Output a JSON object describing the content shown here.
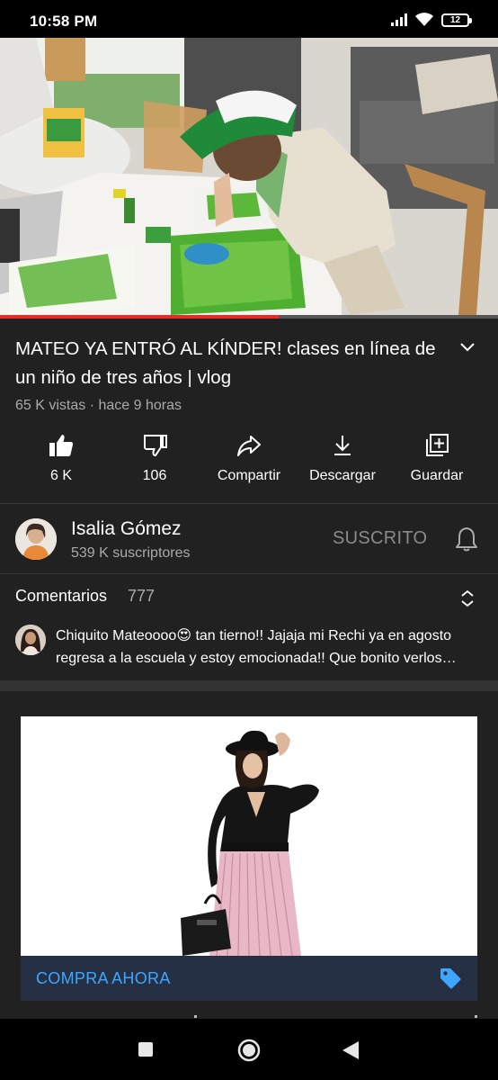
{
  "status_bar": {
    "time": "10:58 PM",
    "battery": "12"
  },
  "video": {
    "progress_percent": 56
  },
  "title": "MATEO YA ENTRÓ AL KÍNDER! clases en línea de un niño de tres años | vlog",
  "meta": "65 K vistas · hace 9 horas",
  "actions": {
    "like": "6 K",
    "dislike": "106",
    "share": "Compartir",
    "download": "Descargar",
    "save": "Guardar"
  },
  "channel": {
    "name": "Isalia Gómez",
    "subscribers": "539 K suscriptores",
    "subscribe_state": "SUSCRITO"
  },
  "comments": {
    "heading": "Comentarios",
    "count": "777",
    "top_comment": "Chiquito Mateoooo😍 tan tierno!! Jajaja mi Rechi ya en agosto regresa a la escuela y estoy emocionada!! Que bonito verlos crecer"
  },
  "ad": {
    "cta": "COMPRA AHORA"
  },
  "colors": {
    "panel_bg": "#212121",
    "progress": "#e52d27",
    "cta_text": "#3ea6ff",
    "cta_bg": "#263044",
    "secondary_text": "#aaaaaa"
  },
  "icons": [
    "thumbs-up-icon",
    "thumbs-down-icon",
    "share-icon",
    "download-icon",
    "save-icon",
    "bell-icon",
    "sort-icon",
    "tag-icon"
  ]
}
